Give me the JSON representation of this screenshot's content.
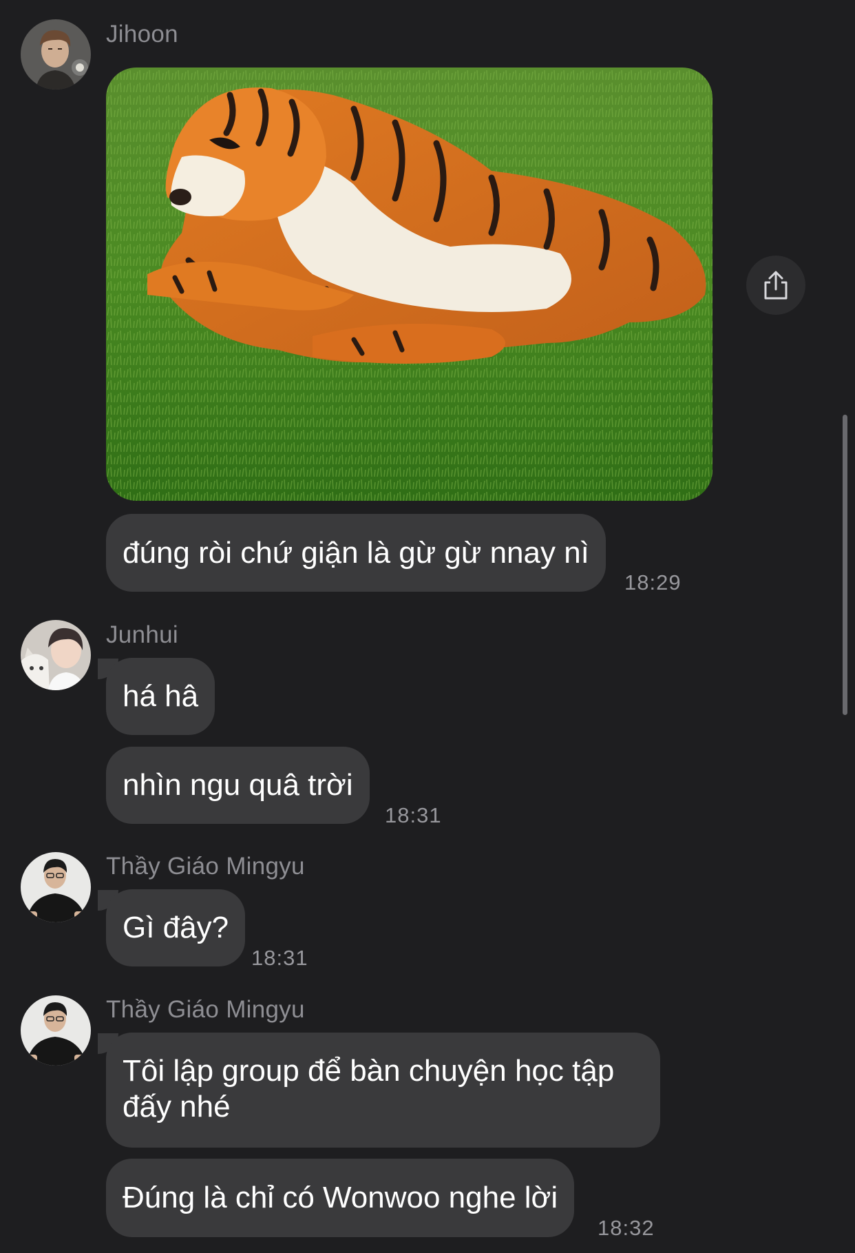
{
  "groups": [
    {
      "sender": "Jihoon",
      "messages": [
        {
          "type": "image",
          "description_icon": "photo-icon"
        },
        {
          "type": "text",
          "text": "đúng ròi chứ giận là gừ gừ nnay nì"
        }
      ],
      "time": "18:29"
    },
    {
      "sender": "Junhui",
      "messages": [
        {
          "type": "text",
          "text": "há hâ"
        },
        {
          "type": "text",
          "text": "nhìn ngu quâ trời"
        }
      ],
      "time": "18:31"
    },
    {
      "sender": "Thầy Giáo Mingyu",
      "messages": [
        {
          "type": "text",
          "text": "Gì đây?"
        }
      ],
      "time": "18:31"
    },
    {
      "sender": "Thầy Giáo Mingyu",
      "messages": [
        {
          "type": "text",
          "text": "Tôi lập group để bàn chuyện học tập đấy nhé"
        },
        {
          "type": "text",
          "text": "Đúng là chỉ có Wonwoo nghe lời"
        }
      ],
      "time": "18:32"
    }
  ],
  "share_button": {
    "icon": "share-icon"
  },
  "colors": {
    "background": "#1e1e20",
    "bubble": "#3a3a3c",
    "sender": "#8e8e93",
    "timestamp": "#98989d"
  }
}
